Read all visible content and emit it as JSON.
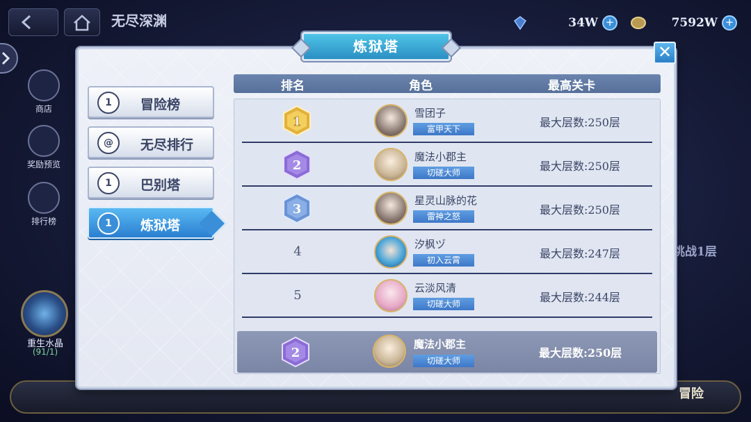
{
  "header": {
    "title": "无尽深渊"
  },
  "currencies": [
    {
      "icon": "gem-icon",
      "amount": "34W"
    },
    {
      "icon": "coin-icon",
      "amount": "7592W"
    }
  ],
  "sidebar": [
    {
      "label": "商店",
      "icon": "shop-icon"
    },
    {
      "label": "奖励预览",
      "icon": "reward-preview-icon"
    },
    {
      "label": "排行榜",
      "icon": "leaderboard-icon"
    }
  ],
  "crystal": {
    "label": "重生水晶",
    "count": "(91/1)"
  },
  "background_hint": "挑战1层",
  "bottom_nav": {
    "adventure_label": "冒险"
  },
  "panel": {
    "title": "炼狱塔",
    "tabs": [
      {
        "label": "冒险榜",
        "icon_text": "1",
        "active": false
      },
      {
        "label": "无尽排行",
        "icon_text": "@",
        "active": false
      },
      {
        "label": "巴别塔",
        "icon_text": "1",
        "active": false
      },
      {
        "label": "炼狱塔",
        "icon_text": "1",
        "active": true
      }
    ],
    "columns": [
      "排名",
      "角色",
      "最高关卡"
    ],
    "rows": [
      {
        "rank": "1",
        "name": "雪团子",
        "title": "富甲天下",
        "floor": "最大层数:250层"
      },
      {
        "rank": "2",
        "name": "魔法小郡主",
        "title": "切磋大师",
        "floor": "最大层数:250层"
      },
      {
        "rank": "3",
        "name": "星灵山脉的花",
        "title": "雷神之怒",
        "floor": "最大层数:250层"
      },
      {
        "rank": "4",
        "name": "汐枫ヅ",
        "title": "初入云霄",
        "floor": "最大层数:247层"
      },
      {
        "rank": "5",
        "name": "云淡风清",
        "title": "切磋大师",
        "floor": "最大层数:244层"
      }
    ],
    "self": {
      "rank": "2",
      "name": "魔法小郡主",
      "title": "切磋大师",
      "floor": "最大层数:250层"
    }
  },
  "colors": {
    "gold": "#e2b13c",
    "purple": "#8a6cd6",
    "blue": "#6a93d6",
    "accent": "#3a8fd8"
  }
}
